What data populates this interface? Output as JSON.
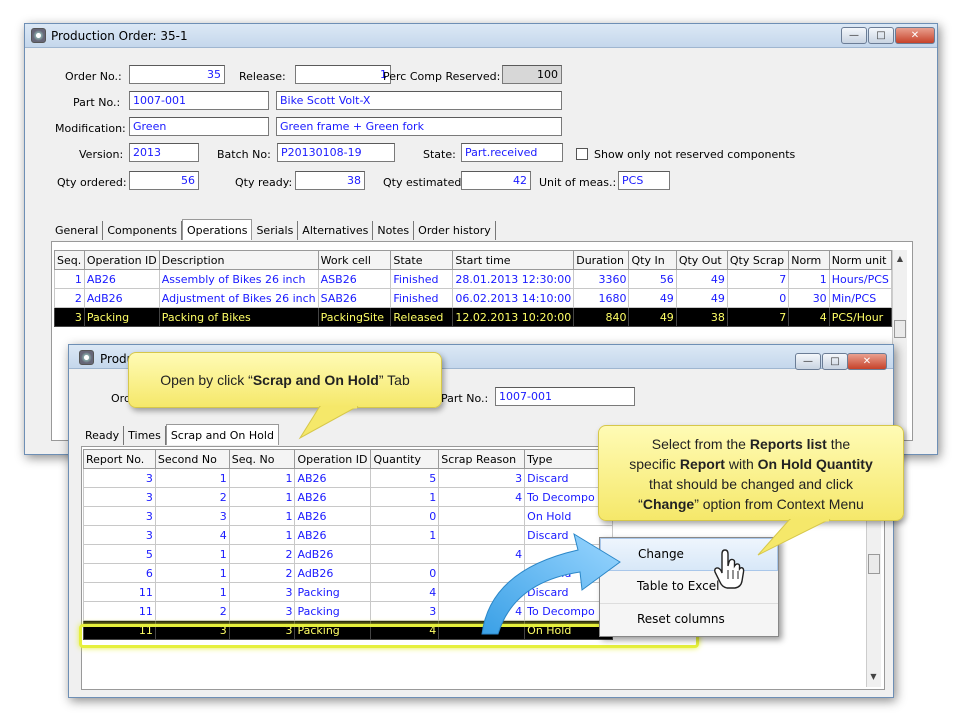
{
  "main_window": {
    "title": "Production Order: 35-1",
    "order_no_label": "Order No.:",
    "order_no": "35",
    "release_label": "Release:",
    "release": "1",
    "perc_comp_label": "Perc Comp Reserved:",
    "perc_comp": "100",
    "part_no_label": "Part No.:",
    "part_no": "1007-001",
    "part_desc": "Bike Scott Volt-X",
    "modification_label": "Modification:",
    "modification": "Green",
    "modification_desc": "Green frame + Green fork",
    "version_label": "Version:",
    "version": "2013",
    "batch_label": "Batch No:",
    "batch": "P20130108-19",
    "state_label": "State:",
    "state": "Part.received",
    "show_only_label": "Show only not reserved components",
    "qty_ordered_label": "Qty ordered:",
    "qty_ordered": "56",
    "qty_ready_label": "Qty ready:",
    "qty_ready": "38",
    "qty_estimated_label": "Qty estimated:",
    "qty_estimated": "42",
    "unit_label": "Unit of meas.:",
    "unit": "PCS",
    "tabs": [
      "General",
      "Components",
      "Operations",
      "Serials",
      "Alternatives",
      "Notes",
      "Order history"
    ],
    "ops_headers": [
      "Seq.",
      "Operation ID",
      "Description",
      "Work cell",
      "State",
      "Start time",
      "Duration",
      "Qty In",
      "Qty Out",
      "Qty Scrap",
      "Norm",
      "Norm unit"
    ],
    "ops_rows": [
      [
        "1",
        "AB26",
        "Assembly of Bikes 26 inch",
        "ASB26",
        "Finished",
        "28.01.2013 12:30:00",
        "3360",
        "56",
        "49",
        "7",
        "1",
        "Hours/PCS"
      ],
      [
        "2",
        "AdB26",
        "Adjustment of Bikes 26 inch",
        "SAB26",
        "Finished",
        "06.02.2013 14:10:00",
        "1680",
        "49",
        "49",
        "0",
        "30",
        "Min/PCS"
      ],
      [
        "3",
        "Packing",
        "Packing of Bikes",
        "PackingSite",
        "Released",
        "12.02.2013 10:20:00",
        "840",
        "49",
        "38",
        "7",
        "4",
        "PCS/Hour"
      ]
    ]
  },
  "sub_window": {
    "title": "Produ",
    "order_label": "Ord",
    "part_no_label": "Part No.:",
    "part_no": "1007-001",
    "tabs": [
      "Ready",
      "Times",
      "Scrap and On Hold"
    ],
    "headers": [
      "Report No.",
      "Second No",
      "Seq. No",
      "Operation ID",
      "Quantity",
      "Scrap Reason",
      "Type"
    ],
    "rows": [
      [
        "3",
        "1",
        "1",
        "AB26",
        "5",
        "3",
        "Discard"
      ],
      [
        "3",
        "2",
        "1",
        "AB26",
        "1",
        "4",
        "To Decompo"
      ],
      [
        "3",
        "3",
        "1",
        "AB26",
        "0",
        "",
        "On Hold"
      ],
      [
        "3",
        "4",
        "1",
        "AB26",
        "1",
        "",
        "Discard"
      ],
      [
        "5",
        "1",
        "2",
        "AdB26",
        "",
        "4",
        ""
      ],
      [
        "6",
        "1",
        "2",
        "AdB26",
        "0",
        "",
        "On Hold"
      ],
      [
        "11",
        "1",
        "3",
        "Packing",
        "4",
        "3",
        "Discard"
      ],
      [
        "11",
        "2",
        "3",
        "Packing",
        "3",
        "4",
        "To Decompo"
      ],
      [
        "11",
        "3",
        "3",
        "Packing",
        "4",
        "",
        "On Hold"
      ]
    ]
  },
  "context_menu": [
    "Change",
    "Table to Excel",
    "Reset columns"
  ],
  "callout1": {
    "pre": "Open by click “",
    "bold": "Scrap and On Hold",
    "post": "” Tab"
  },
  "callout2": {
    "l1a": "Select from the ",
    "l1b": "Reports list",
    "l1c": " the",
    "l2a": "specific ",
    "l2b": "Report",
    "l2c": " with ",
    "l2d": "On Hold Quantity",
    "l3": "that should be changed and click",
    "l4a": "“",
    "l4b": "Change",
    "l4c": "” option from Context Menu"
  }
}
